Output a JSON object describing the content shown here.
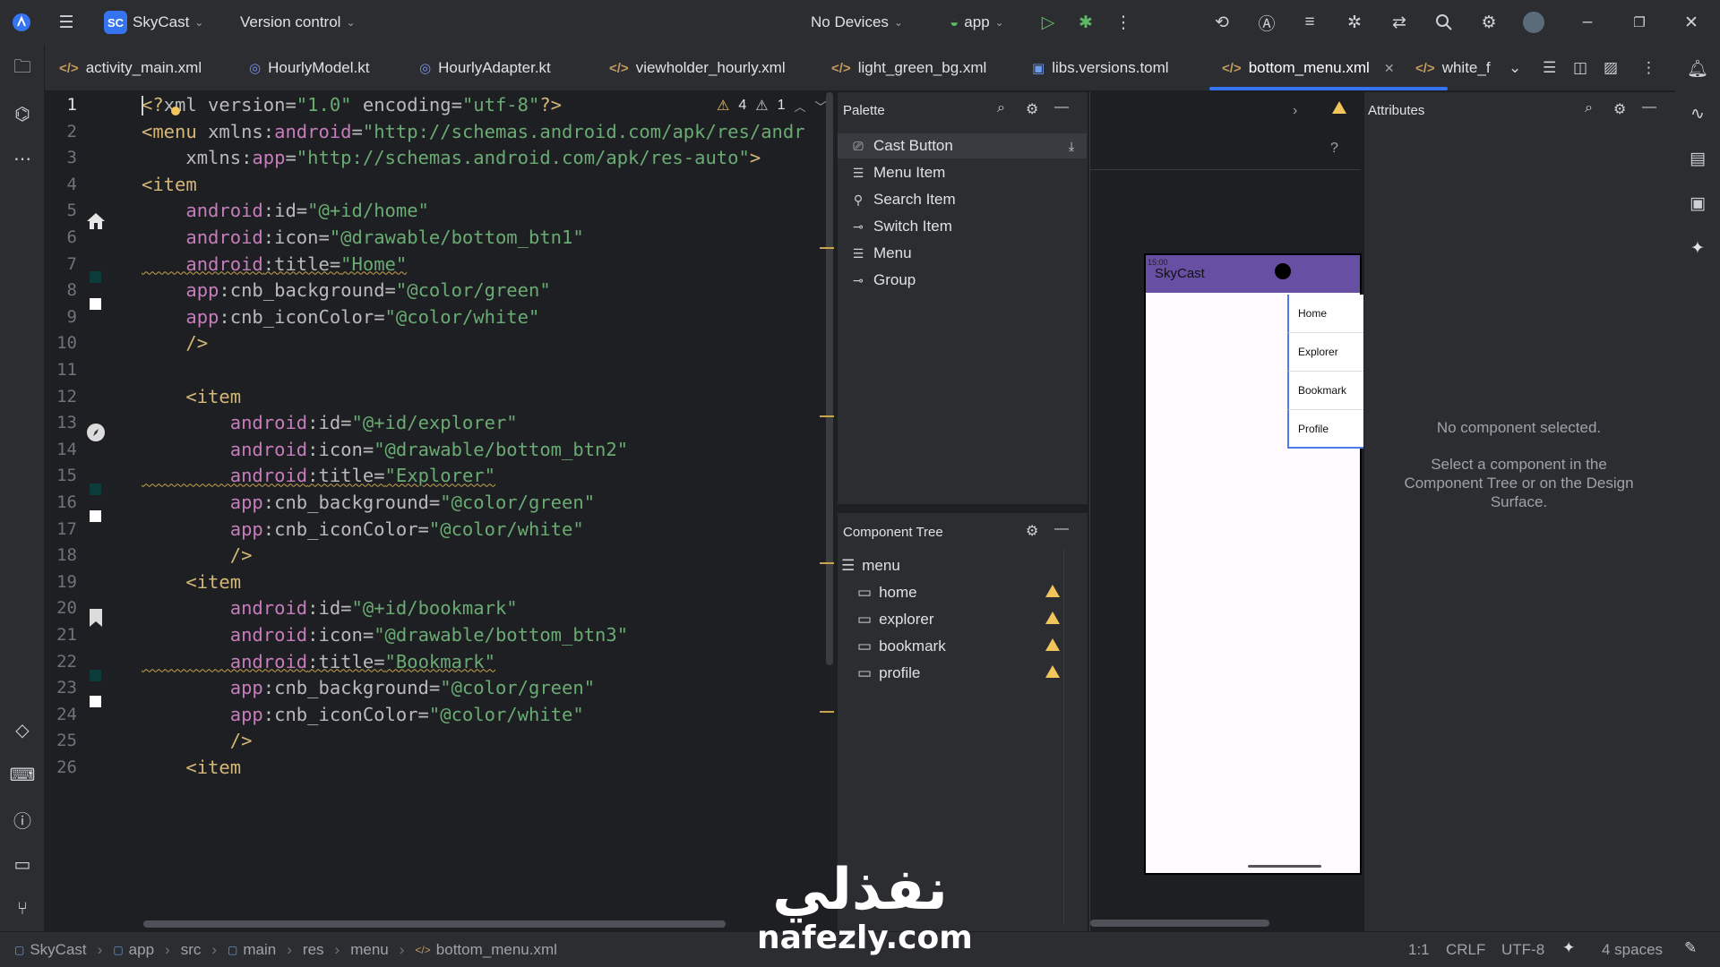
{
  "topbar": {
    "project_badge": "SC",
    "project_name": "SkyCast",
    "vcs": "Version control",
    "devices": "No Devices",
    "run_config": "app"
  },
  "tabs": [
    {
      "label": "activity_main.xml",
      "icon": "xml-icon"
    },
    {
      "label": "HourlyModel.kt",
      "icon": "kotlin-class-icon"
    },
    {
      "label": "HourlyAdapter.kt",
      "icon": "kotlin-class-icon"
    },
    {
      "label": "viewholder_hourly.xml",
      "icon": "xml-icon"
    },
    {
      "label": "light_green_bg.xml",
      "icon": "xml-icon"
    },
    {
      "label": "libs.versions.toml",
      "icon": "toml-icon"
    },
    {
      "label": "bottom_menu.xml",
      "icon": "xml-icon",
      "active": true
    },
    {
      "label": "white_f",
      "icon": "xml-icon"
    }
  ],
  "editor": {
    "warnings": "4",
    "weak_warnings": "1",
    "line_numbers": [
      "1",
      "2",
      "3",
      "4",
      "5",
      "6",
      "7",
      "8",
      "9",
      "10",
      "11",
      "12",
      "13",
      "14",
      "15",
      "16",
      "17",
      "18",
      "19",
      "20",
      "21",
      "22",
      "23",
      "24",
      "25",
      "26"
    ],
    "lines": [
      {
        "parts": [
          [
            "t-br",
            "<?"
          ],
          [
            "t-attr",
            "xml version="
          ],
          [
            "t-val",
            "\"1.0\""
          ],
          [
            "t-attr",
            " encoding="
          ],
          [
            "t-val",
            "\"utf-8\""
          ],
          [
            "t-br",
            "?>"
          ]
        ]
      },
      {
        "parts": [
          [
            "t-tag",
            "<menu "
          ],
          [
            "t-attr",
            "xmlns:"
          ],
          [
            "t-ns",
            "android"
          ],
          [
            "t-attr",
            "="
          ],
          [
            "t-val",
            "\"http://schemas.android.com/apk/res/andr"
          ]
        ]
      },
      {
        "parts": [
          [
            "t-attr",
            "    xmlns:"
          ],
          [
            "t-ns",
            "app"
          ],
          [
            "t-attr",
            "="
          ],
          [
            "t-val",
            "\"http://schemas.android.com/apk/res-auto\""
          ],
          [
            "t-tag",
            ">"
          ]
        ]
      },
      {
        "parts": [
          [
            "t-tag",
            "<item"
          ]
        ]
      },
      {
        "parts": [
          [
            "t-ns",
            "    android"
          ],
          [
            "t-attr",
            ":id="
          ],
          [
            "t-val",
            "\"@+id/home\""
          ]
        ]
      },
      {
        "parts": [
          [
            "t-ns",
            "    android"
          ],
          [
            "t-attr",
            ":icon="
          ],
          [
            "t-val",
            "\"@drawable/bottom_btn1\""
          ]
        ]
      },
      {
        "parts": [
          [
            "t-ns wavy",
            "    android"
          ],
          [
            "t-attr wavy",
            ":title="
          ],
          [
            "t-val wavy",
            "\"Home\""
          ]
        ]
      },
      {
        "parts": [
          [
            "t-ns",
            "    app"
          ],
          [
            "t-attr",
            ":cnb_background="
          ],
          [
            "t-val",
            "\"@color/green\""
          ]
        ]
      },
      {
        "parts": [
          [
            "t-ns",
            "    app"
          ],
          [
            "t-attr",
            ":cnb_iconColor="
          ],
          [
            "t-val",
            "\"@color/white\""
          ]
        ]
      },
      {
        "parts": [
          [
            "t-tag",
            "    />"
          ]
        ]
      },
      {
        "parts": [
          [
            "t-attr",
            ""
          ]
        ]
      },
      {
        "parts": [
          [
            "t-tag",
            "    <item"
          ]
        ]
      },
      {
        "parts": [
          [
            "t-ns",
            "        android"
          ],
          [
            "t-attr",
            ":id="
          ],
          [
            "t-val",
            "\"@+id/explorer\""
          ]
        ]
      },
      {
        "parts": [
          [
            "t-ns",
            "        android"
          ],
          [
            "t-attr",
            ":icon="
          ],
          [
            "t-val",
            "\"@drawable/bottom_btn2\""
          ]
        ]
      },
      {
        "parts": [
          [
            "t-ns wavy",
            "        android"
          ],
          [
            "t-attr wavy",
            ":title="
          ],
          [
            "t-val wavy",
            "\"Explorer\""
          ]
        ]
      },
      {
        "parts": [
          [
            "t-ns",
            "        app"
          ],
          [
            "t-attr",
            ":cnb_background="
          ],
          [
            "t-val",
            "\"@color/green\""
          ]
        ]
      },
      {
        "parts": [
          [
            "t-ns",
            "        app"
          ],
          [
            "t-attr",
            ":cnb_iconColor="
          ],
          [
            "t-val",
            "\"@color/white\""
          ]
        ]
      },
      {
        "parts": [
          [
            "t-tag",
            "        />"
          ]
        ]
      },
      {
        "parts": [
          [
            "t-tag",
            "    <item"
          ]
        ]
      },
      {
        "parts": [
          [
            "t-ns",
            "        android"
          ],
          [
            "t-attr",
            ":id="
          ],
          [
            "t-val",
            "\"@+id/bookmark\""
          ]
        ]
      },
      {
        "parts": [
          [
            "t-ns",
            "        android"
          ],
          [
            "t-attr",
            ":icon="
          ],
          [
            "t-val",
            "\"@drawable/bottom_btn3\""
          ]
        ]
      },
      {
        "parts": [
          [
            "t-ns wavy",
            "        android"
          ],
          [
            "t-attr wavy",
            ":title="
          ],
          [
            "t-val wavy",
            "\"Bookmark\""
          ]
        ]
      },
      {
        "parts": [
          [
            "t-ns",
            "        app"
          ],
          [
            "t-attr",
            ":cnb_background="
          ],
          [
            "t-val",
            "\"@color/green\""
          ]
        ]
      },
      {
        "parts": [
          [
            "t-ns",
            "        app"
          ],
          [
            "t-attr",
            ":cnb_iconColor="
          ],
          [
            "t-val",
            "\"@color/white\""
          ]
        ]
      },
      {
        "parts": [
          [
            "t-tag",
            "        />"
          ]
        ]
      },
      {
        "parts": [
          [
            "t-tag",
            "    <item"
          ]
        ]
      }
    ]
  },
  "palette": {
    "title": "Palette",
    "items": [
      {
        "label": "Cast Button",
        "icon": "cast-icon"
      },
      {
        "label": "Menu Item",
        "icon": "list-icon"
      },
      {
        "label": "Search Item",
        "icon": "search-icon"
      },
      {
        "label": "Switch Item",
        "icon": "switch-icon"
      },
      {
        "label": "Menu",
        "icon": "menu-icon"
      },
      {
        "label": "Group",
        "icon": "group-icon"
      }
    ]
  },
  "component_tree": {
    "title": "Component Tree",
    "root": "menu",
    "children": [
      "home",
      "explorer",
      "bookmark",
      "profile"
    ]
  },
  "preview": {
    "time": "15:00",
    "app_title": "SkyCast",
    "menu_options": [
      "Home",
      "Explorer",
      "Bookmark",
      "Profile"
    ],
    "toolbar_color": "#6750a4"
  },
  "attributes": {
    "title": "Attributes",
    "empty_title": "No component selected.",
    "empty_hint": "Select a component in the Component Tree or on the Design Surface."
  },
  "status": {
    "breadcrumb": [
      "SkyCast",
      "app",
      "src",
      "main",
      "res",
      "menu",
      "bottom_menu.xml"
    ],
    "position": "1:1",
    "line_ending": "CRLF",
    "encoding": "UTF-8",
    "indent": "4 spaces"
  },
  "watermark": {
    "arabic": "نفذلي",
    "latin": "nafezly.com"
  },
  "colors": {
    "accent": "#3574f0",
    "warning": "#f2c55c",
    "panel_bg": "#2b2d30",
    "editor_bg": "#1e1f22"
  }
}
